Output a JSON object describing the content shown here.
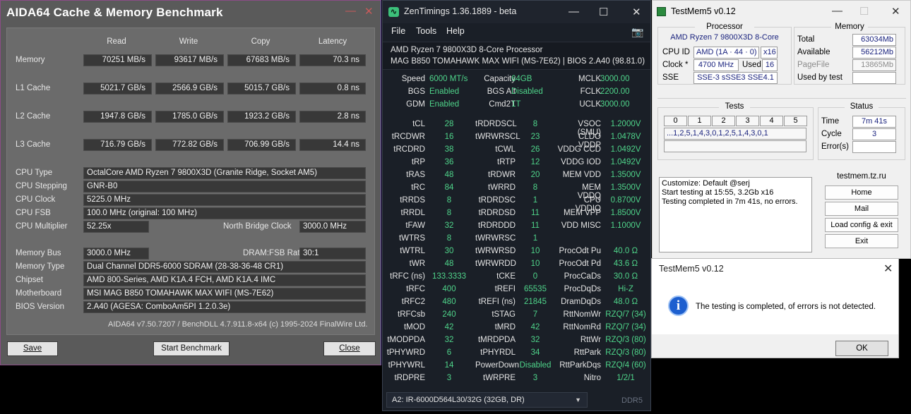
{
  "aida": {
    "title": "AIDA64 Cache & Memory Benchmark",
    "minimize": "—",
    "close": "✕",
    "headers": [
      "Read",
      "Write",
      "Copy",
      "Latency"
    ],
    "bench_rows": [
      {
        "label": "Memory",
        "read": "70251 MB/s",
        "write": "93617 MB/s",
        "copy": "67683 MB/s",
        "latency": "70.3 ns"
      },
      {
        "label": "L1 Cache",
        "read": "5021.7 GB/s",
        "write": "2566.9 GB/s",
        "copy": "5015.7 GB/s",
        "latency": "0.8 ns"
      },
      {
        "label": "L2 Cache",
        "read": "1947.8 GB/s",
        "write": "1785.0 GB/s",
        "copy": "1923.2 GB/s",
        "latency": "2.8 ns"
      },
      {
        "label": "L3 Cache",
        "read": "716.79 GB/s",
        "write": "772.82 GB/s",
        "copy": "706.99 GB/s",
        "latency": "14.4 ns"
      }
    ],
    "cpu_type_label": "CPU Type",
    "cpu_type": "OctalCore AMD Ryzen 7 9800X3D  (Granite Ridge, Socket AM5)",
    "cpu_stepping_label": "CPU Stepping",
    "cpu_stepping": "GNR-B0",
    "cpu_clock_label": "CPU Clock",
    "cpu_clock": "5225.0 MHz",
    "cpu_fsb_label": "CPU FSB",
    "cpu_fsb": "100.0 MHz  (original: 100 MHz)",
    "cpu_mult_label": "CPU Multiplier",
    "cpu_mult": "52.25x",
    "nb_clock_label": "North Bridge Clock",
    "nb_clock": "3000.0 MHz",
    "mem_bus_label": "Memory Bus",
    "mem_bus": "3000.0 MHz",
    "dram_fsb_label": "DRAM:FSB Ratio",
    "dram_fsb": "30:1",
    "mem_type_label": "Memory Type",
    "mem_type": "Dual Channel DDR5-6000 SDRAM  (28-38-36-48 CR1)",
    "chipset_label": "Chipset",
    "chipset": "AMD 800-Series, AMD K1A.4 FCH, AMD K1A.4 IMC",
    "mobo_label": "Motherboard",
    "mobo": "MSI MAG B850 TOMAHAWK MAX WIFI (MS-7E62)",
    "bios_label": "BIOS Version",
    "bios": "2.A40  (AGESA: ComboAm5PI 1.2.0.3e)",
    "version": "AIDA64 v7.50.7207 / BenchDLL 4.7.911.8-x64  (c) 1995-2024 FinalWire Ltd.",
    "save": "Save",
    "start": "Start Benchmark",
    "close_btn": "Close"
  },
  "zen": {
    "title": "ZenTimings 1.36.1889 - beta",
    "menu": [
      "File",
      "Tools",
      "Help"
    ],
    "camera_icon": "camera-icon",
    "cpu": "AMD Ryzen 7 9800X3D 8-Core Processor",
    "board": "MAG B850 TOMAHAWK MAX WIFI (MS-7E62) | BIOS 2.A40 (98.81.0)",
    "top_left": [
      {
        "k": "Speed",
        "v": "6000 MT/s"
      },
      {
        "k": "BGS",
        "v": "Enabled"
      },
      {
        "k": "GDM",
        "v": "Enabled"
      }
    ],
    "top_mid": [
      {
        "k": "Capacity",
        "v": "64GB"
      },
      {
        "k": "BGS Alt",
        "v": "Disabled"
      },
      {
        "k": "Cmd2T",
        "v": "1T"
      }
    ],
    "top_right": [
      {
        "k": "MCLK",
        "v": "3000.00"
      },
      {
        "k": "FCLK",
        "v": "2200.00"
      },
      {
        "k": "UCLK",
        "v": "3000.00"
      }
    ],
    "col1": [
      {
        "k": "tCL",
        "v": "28"
      },
      {
        "k": "tRCDWR",
        "v": "16"
      },
      {
        "k": "tRCDRD",
        "v": "38"
      },
      {
        "k": "tRP",
        "v": "36"
      },
      {
        "k": "tRAS",
        "v": "48"
      },
      {
        "k": "tRC",
        "v": "84"
      },
      {
        "k": "tRRDS",
        "v": "8"
      },
      {
        "k": "tRRDL",
        "v": "8"
      },
      {
        "k": "tFAW",
        "v": "32"
      },
      {
        "k": "tWTRS",
        "v": "8"
      },
      {
        "k": "tWTRL",
        "v": "30"
      },
      {
        "k": "tWR",
        "v": "48"
      },
      {
        "k": "tRFC (ns)",
        "v": "133.3333"
      },
      {
        "k": "tRFC",
        "v": "400"
      },
      {
        "k": "tRFC2",
        "v": "480"
      },
      {
        "k": "tRFCsb",
        "v": "240"
      },
      {
        "k": "tMOD",
        "v": "42"
      },
      {
        "k": "tMODPDA",
        "v": "32"
      },
      {
        "k": "tPHYWRD",
        "v": "6"
      },
      {
        "k": "tPHYWRL",
        "v": "14"
      },
      {
        "k": "tRDPRE",
        "v": "3"
      }
    ],
    "col2": [
      {
        "k": "tRDRDSCL",
        "v": "8"
      },
      {
        "k": "tWRWRSCL",
        "v": "23"
      },
      {
        "k": "tCWL",
        "v": "26"
      },
      {
        "k": "tRTP",
        "v": "12"
      },
      {
        "k": "tRDWR",
        "v": "20"
      },
      {
        "k": "tWRRD",
        "v": "8"
      },
      {
        "k": "tRDRDSC",
        "v": "1"
      },
      {
        "k": "tRDRDSD",
        "v": "11"
      },
      {
        "k": "tRDRDDD",
        "v": "11"
      },
      {
        "k": "tWRWRSC",
        "v": "1"
      },
      {
        "k": "tWRWRSD",
        "v": "10"
      },
      {
        "k": "tWRWRDD",
        "v": "10"
      },
      {
        "k": "tCKE",
        "v": "0"
      },
      {
        "k": "tREFI",
        "v": "65535"
      },
      {
        "k": "tREFI (ns)",
        "v": "21845"
      },
      {
        "k": "tSTAG",
        "v": "7"
      },
      {
        "k": "tMRD",
        "v": "42"
      },
      {
        "k": "tMRDPDA",
        "v": "32"
      },
      {
        "k": "tPHYRDL",
        "v": "34"
      },
      {
        "k": "PowerDown",
        "v": "Disabled"
      },
      {
        "k": "tWRPRE",
        "v": "3"
      }
    ],
    "col3": [
      {
        "k": "VSOC (SMU)",
        "v": "1.2000V"
      },
      {
        "k": "CLDO VDDP",
        "v": "1.0478V"
      },
      {
        "k": "VDDG CCD",
        "v": "1.0492V"
      },
      {
        "k": "VDDG IOD",
        "v": "1.0492V"
      },
      {
        "k": "MEM VDD",
        "v": "1.3500V"
      },
      {
        "k": "MEM VDDQ",
        "v": "1.3500V"
      },
      {
        "k": "CPU VDDIO",
        "v": "0.8700V"
      },
      {
        "k": "MEM VPP",
        "v": "1.8500V"
      },
      {
        "k": "VDD MISC",
        "v": "1.1000V"
      },
      {
        "k": "",
        "v": ""
      },
      {
        "k": "ProcOdt Pu",
        "v": "40.0 Ω"
      },
      {
        "k": "ProcOdt Pd",
        "v": "43.6 Ω"
      },
      {
        "k": "ProcCaDs",
        "v": "30.0 Ω"
      },
      {
        "k": "ProcDqDs",
        "v": "Hi-Z"
      },
      {
        "k": "DramDqDs",
        "v": "48.0 Ω"
      },
      {
        "k": "RttNomWr",
        "v": "RZQ/7 (34)"
      },
      {
        "k": "RttNomRd",
        "v": "RZQ/7 (34)"
      },
      {
        "k": "RttWr",
        "v": "RZQ/3 (80)"
      },
      {
        "k": "RttPark",
        "v": "RZQ/3 (80)"
      },
      {
        "k": "RttParkDqs",
        "v": "RZQ/4 (60)"
      },
      {
        "k": "Nitro",
        "v": "1/2/1"
      }
    ],
    "dimm": "A2: IR-6000D564L30/32G (32GB, DR)",
    "ddr": "DDR5"
  },
  "tm": {
    "title": "TestMem5 v0.12",
    "processor_title": "Processor",
    "cpu_name": "AMD Ryzen 7 9800X3D 8-Core",
    "cpu_id_label": "CPU ID",
    "cpu_id": "AMD  (1A · 44 · 0)",
    "cpu_threads": "x16",
    "clock_label": "Clock *",
    "clock": "4700 MHz",
    "used_label": "Used",
    "used": "16",
    "sse_label": "SSE",
    "sse": "SSE-3 sSSE3 SSE4.1",
    "memory_title": "Memory",
    "total_label": "Total",
    "total": "63034Mb",
    "avail_label": "Available",
    "avail": "56212Mb",
    "pagefile_label": "PageFile",
    "pagefile": "13865Mb",
    "usedby_label": "Used by test",
    "usedby": "",
    "tests_title": "Tests",
    "tests_cols": [
      "0",
      "1",
      "2",
      "3",
      "4",
      "5"
    ],
    "tests_seq": "...1,2,5,1,4,3,0,1,2,5,1,4,3,0,1",
    "status_title": "Status",
    "time_label": "Time",
    "time": "7m 41s",
    "cycle_label": "Cycle",
    "cycle": "3",
    "errors_label": "Error(s)",
    "errors": "",
    "log": [
      "Customize: Default @serj",
      "Start testing at 15:55, 3.2Gb x16",
      "Testing completed in 7m 41s, no errors."
    ],
    "site": "testmem.tz.ru",
    "home": "Home",
    "mail": "Mail",
    "load": "Load config & exit",
    "exit": "Exit"
  },
  "dlg": {
    "title": "TestMem5 v0.12",
    "message": "The testing is completed, of errors is not detected.",
    "ok": "OK"
  },
  "colors": {
    "zen_value": "#4fd48a",
    "aida_bg": "#5a5a5a",
    "tm_field_text": "#1a237e",
    "info_icon": "#1d5fcf"
  }
}
